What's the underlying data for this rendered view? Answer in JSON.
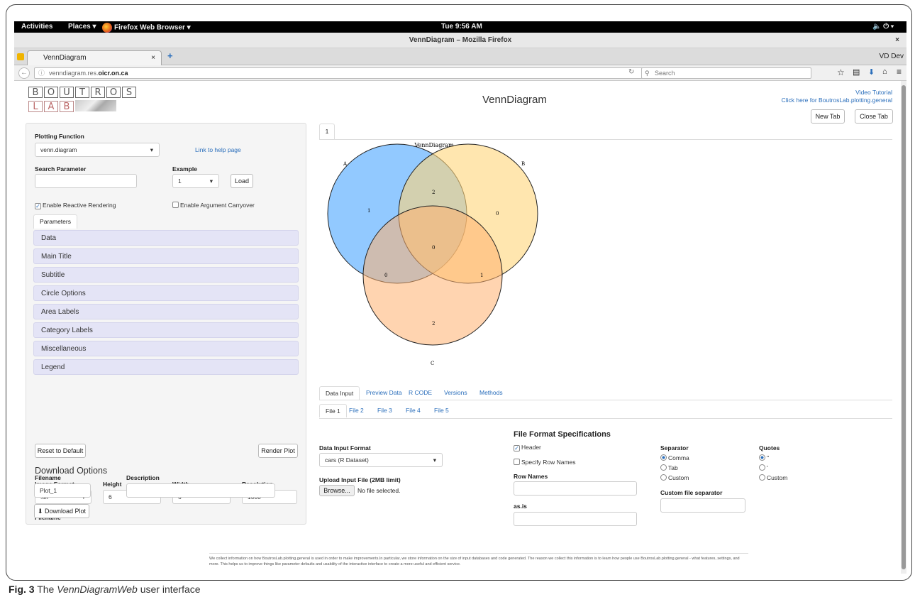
{
  "system_bar": {
    "activities": "Activities",
    "places": "Places",
    "app": "Firefox Web Browser",
    "clock": "Tue  9:56 AM"
  },
  "window": {
    "title": "VennDiagram – Mozilla Firefox",
    "tab_label": "VennDiagram",
    "user": "VD Dev"
  },
  "nav": {
    "url_prefix": "venndiagram.res.",
    "url_bold": "oicr.on.ca",
    "search_placeholder": "Search"
  },
  "header": {
    "logo_row1": [
      "B",
      "O",
      "U",
      "T",
      "R",
      "O",
      "S"
    ],
    "logo_row2": [
      "L",
      "A",
      "B"
    ],
    "title": "VennDiagram",
    "video_link": "Video Tutorial",
    "plotting_link": "Click here for BoutrosLab.plotting.general",
    "new_tab": "New Tab",
    "close_tab": "Close Tab"
  },
  "sidebar": {
    "plotting_function_label": "Plotting Function",
    "plotting_function_value": "venn.diagram",
    "help_link": "Link to help page",
    "search_label": "Search Parameter",
    "example_label": "Example",
    "example_value": "1",
    "load_label": "Load",
    "reactive_label": "Enable Reactive Rendering",
    "carryover_label": "Enable Argument Carryover",
    "params_tab": "Parameters",
    "sections": [
      "Data",
      "Main Title",
      "Subtitle",
      "Circle Options",
      "Area Labels",
      "Category Labels",
      "Miscellaneous",
      "Legend"
    ],
    "reset_label": "Reset to Default",
    "render_label": "Render Plot",
    "download_title": "Download Options",
    "image_format_label": "Image Format",
    "image_format_value": ".tiff",
    "height_label": "Height",
    "height_value": "6",
    "width_label": "Width",
    "width_value": "6",
    "resolution_label": "Resolution",
    "resolution_value": "1000",
    "filename_label": "Filename",
    "filename_value": "Plot_1",
    "description_label": "Description",
    "download_label": "Download Plot"
  },
  "plot": {
    "tab": "1",
    "title": "VennDiagram",
    "set_a": "A",
    "set_b": "B",
    "set_c": "C",
    "regions": {
      "a_only": "1",
      "b_only": "0",
      "c_only": "2",
      "ab": "2",
      "ac": "0",
      "bc": "1",
      "abc": "0"
    },
    "colors": {
      "a": "#7fbfff",
      "b": "#ffd67a",
      "c": "#ffb070"
    }
  },
  "data_tabs": [
    "Data Input",
    "Preview Data",
    "R CODE",
    "Versions",
    "Methods"
  ],
  "file_tabs": [
    "File 1",
    "File 2",
    "File 3",
    "File 4",
    "File 5"
  ],
  "input": {
    "format_label": "Data Input Format",
    "format_value": "cars (R Dataset)",
    "upload_label": "Upload Input File (2MB limit)",
    "browse": "Browse...",
    "no_file": "No file selected."
  },
  "spec": {
    "title": "File Format Specifications",
    "header": "Header",
    "row_names_chk": "Specify Row Names",
    "row_names_label": "Row Names",
    "asis_label": "as.is",
    "separator_label": "Separator",
    "sep_options": [
      "Comma",
      "Tab",
      "Custom"
    ],
    "custom_sep_label": "Custom file separator",
    "quotes_label": "Quotes",
    "quote_options": [
      "\"",
      "'",
      "Custom"
    ]
  },
  "footnote": "We collect information on how BoutrosLab.plotting.general is used in order to make improvements.In particular, we store information on the size of input databases and code generated. The reason we collect this information is to learn how people use BoutrosLab.plotting.general - what features, settings, and more. This helps us to improve things like parameter defaults and usability of the interactive interface to create a more useful and efficient service.",
  "caption": {
    "fig": "Fig. 3",
    "pre": "The ",
    "app": "VennDiagramWeb",
    "post": " user interface"
  }
}
